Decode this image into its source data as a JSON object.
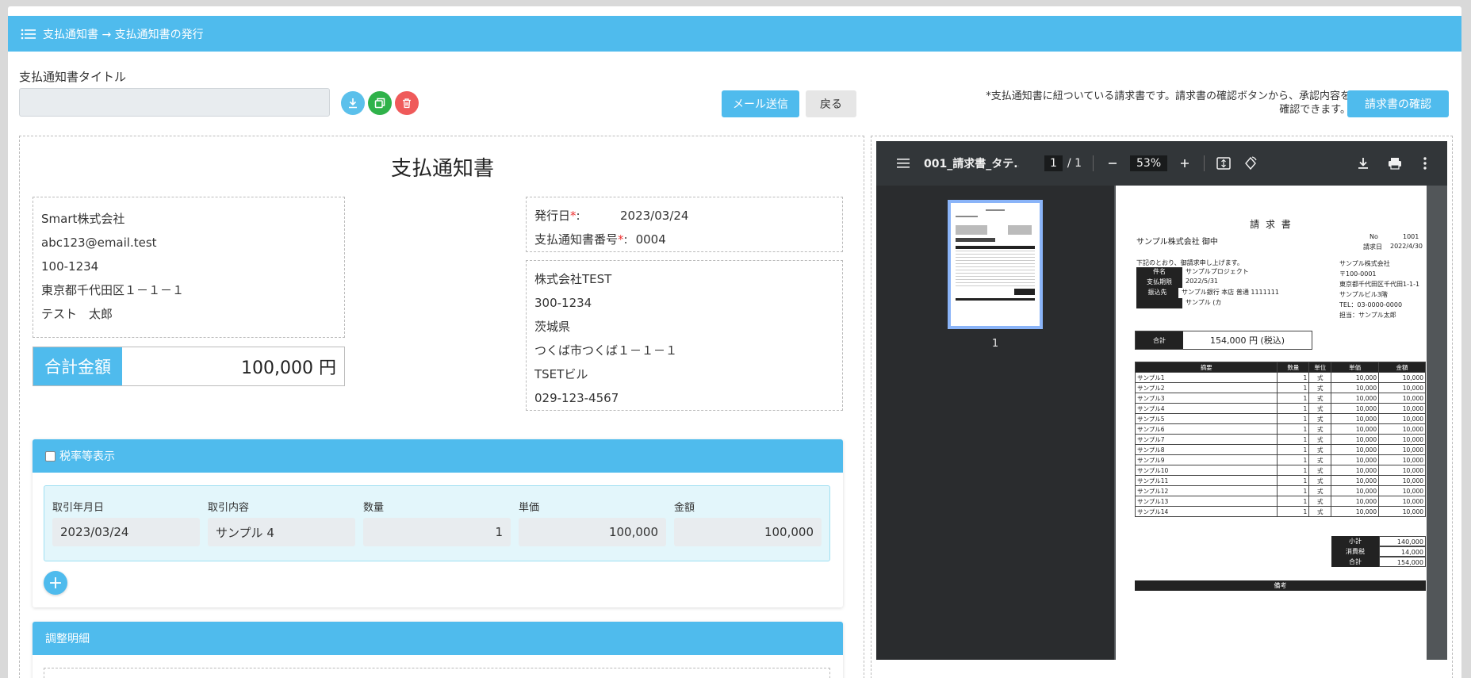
{
  "header": {
    "breadcrumb": "支払通知書 → 支払通知書の発行"
  },
  "toolbar": {
    "title_label": "支払通知書タイトル",
    "title_value": "",
    "mail_button": "メール送信",
    "back_button": "戻る",
    "note": "*支払通知書に紐ついている請求書です。請求書の確認ボタンから、承認内容を確認できます。",
    "confirm_button": "請求書の確認"
  },
  "document": {
    "title": "支払通知書",
    "sender": {
      "company": "Smart株式会社",
      "email": "abc123@email.test",
      "postal": "100-1234",
      "address": "東京都千代田区１－１－１",
      "person": "テスト　太郎"
    },
    "total": {
      "label": "合計金額",
      "value": "100,000 円"
    },
    "issue": {
      "date_label": "発行日",
      "date_value": "2023/03/24",
      "number_label": "支払通知書番号",
      "number_value": "0004",
      "required_mark": "*",
      "colon": ":"
    },
    "recipient": {
      "company": "株式会社TEST",
      "postal": "300-1234",
      "prefecture": "茨城県",
      "address": "つくば市つくば１－１－１",
      "building": "TSETビル",
      "phone": "029-123-4567"
    },
    "tax_section": {
      "checkbox_label": "税率等表示",
      "columns": [
        "取引年月日",
        "取引内容",
        "数量",
        "単価",
        "金額"
      ],
      "row": {
        "date": "2023/03/24",
        "content": "サンプル 4",
        "qty": "1",
        "unit_price": "100,000",
        "amount": "100,000"
      }
    },
    "adjust_section": {
      "title": "調整明細"
    }
  },
  "pdf_viewer": {
    "filename": "001_請求書_タテ...",
    "page_current": "1",
    "page_total": "/ 1",
    "zoom": "53%",
    "thumb_label": "1",
    "invoice": {
      "title": "請 求 書",
      "to": "サンプル株式会社 御中",
      "no_label": "No",
      "no_value": "1001",
      "date_label": "請求日",
      "date_value": "2022/4/30",
      "intro": "下記のとおり、御請求申し上げます。",
      "fields": [
        {
          "label": "件名",
          "value": "サンプルプロジェクト"
        },
        {
          "label": "支払期限",
          "value": "2022/5/31"
        },
        {
          "label": "振込先",
          "value": "サンプル銀行 本店 普通 1111111"
        }
      ],
      "bank_name": "サンプル (カ",
      "issuer": [
        "サンプル株式会社",
        "〒100-0001",
        "東京都千代田区千代田1-1-1",
        "サンプルビル3階",
        "TEL：03-0000-0000",
        "担当：サンプル太郎"
      ],
      "total_label": "合計",
      "total_value": "154,000 円 (税込)",
      "columns": [
        "摘要",
        "数量",
        "単位",
        "単価",
        "金額"
      ],
      "items": [
        [
          "サンプル1",
          "1",
          "式",
          "10,000",
          "10,000"
        ],
        [
          "サンプル2",
          "1",
          "式",
          "10,000",
          "10,000"
        ],
        [
          "サンプル3",
          "1",
          "式",
          "10,000",
          "10,000"
        ],
        [
          "サンプル4",
          "1",
          "式",
          "10,000",
          "10,000"
        ],
        [
          "サンプル5",
          "1",
          "式",
          "10,000",
          "10,000"
        ],
        [
          "サンプル6",
          "1",
          "式",
          "10,000",
          "10,000"
        ],
        [
          "サンプル7",
          "1",
          "式",
          "10,000",
          "10,000"
        ],
        [
          "サンプル8",
          "1",
          "式",
          "10,000",
          "10,000"
        ],
        [
          "サンプル9",
          "1",
          "式",
          "10,000",
          "10,000"
        ],
        [
          "サンプル10",
          "1",
          "式",
          "10,000",
          "10,000"
        ],
        [
          "サンプル11",
          "1",
          "式",
          "10,000",
          "10,000"
        ],
        [
          "サンプル12",
          "1",
          "式",
          "10,000",
          "10,000"
        ],
        [
          "サンプル13",
          "1",
          "式",
          "10,000",
          "10,000"
        ],
        [
          "サンプル14",
          "1",
          "式",
          "10,000",
          "10,000"
        ]
      ],
      "summary": [
        {
          "label": "小計",
          "value": "140,000"
        },
        {
          "label": "消費税",
          "value": "14,000"
        },
        {
          "label": "合計",
          "value": "154,000"
        }
      ],
      "remarks_label": "備考"
    }
  },
  "colors": {
    "accent": "#4fbbed",
    "download": "#5bc0eb",
    "copy": "#2fb24a",
    "delete": "#ef5a5a",
    "viewer_bg": "#323639"
  }
}
